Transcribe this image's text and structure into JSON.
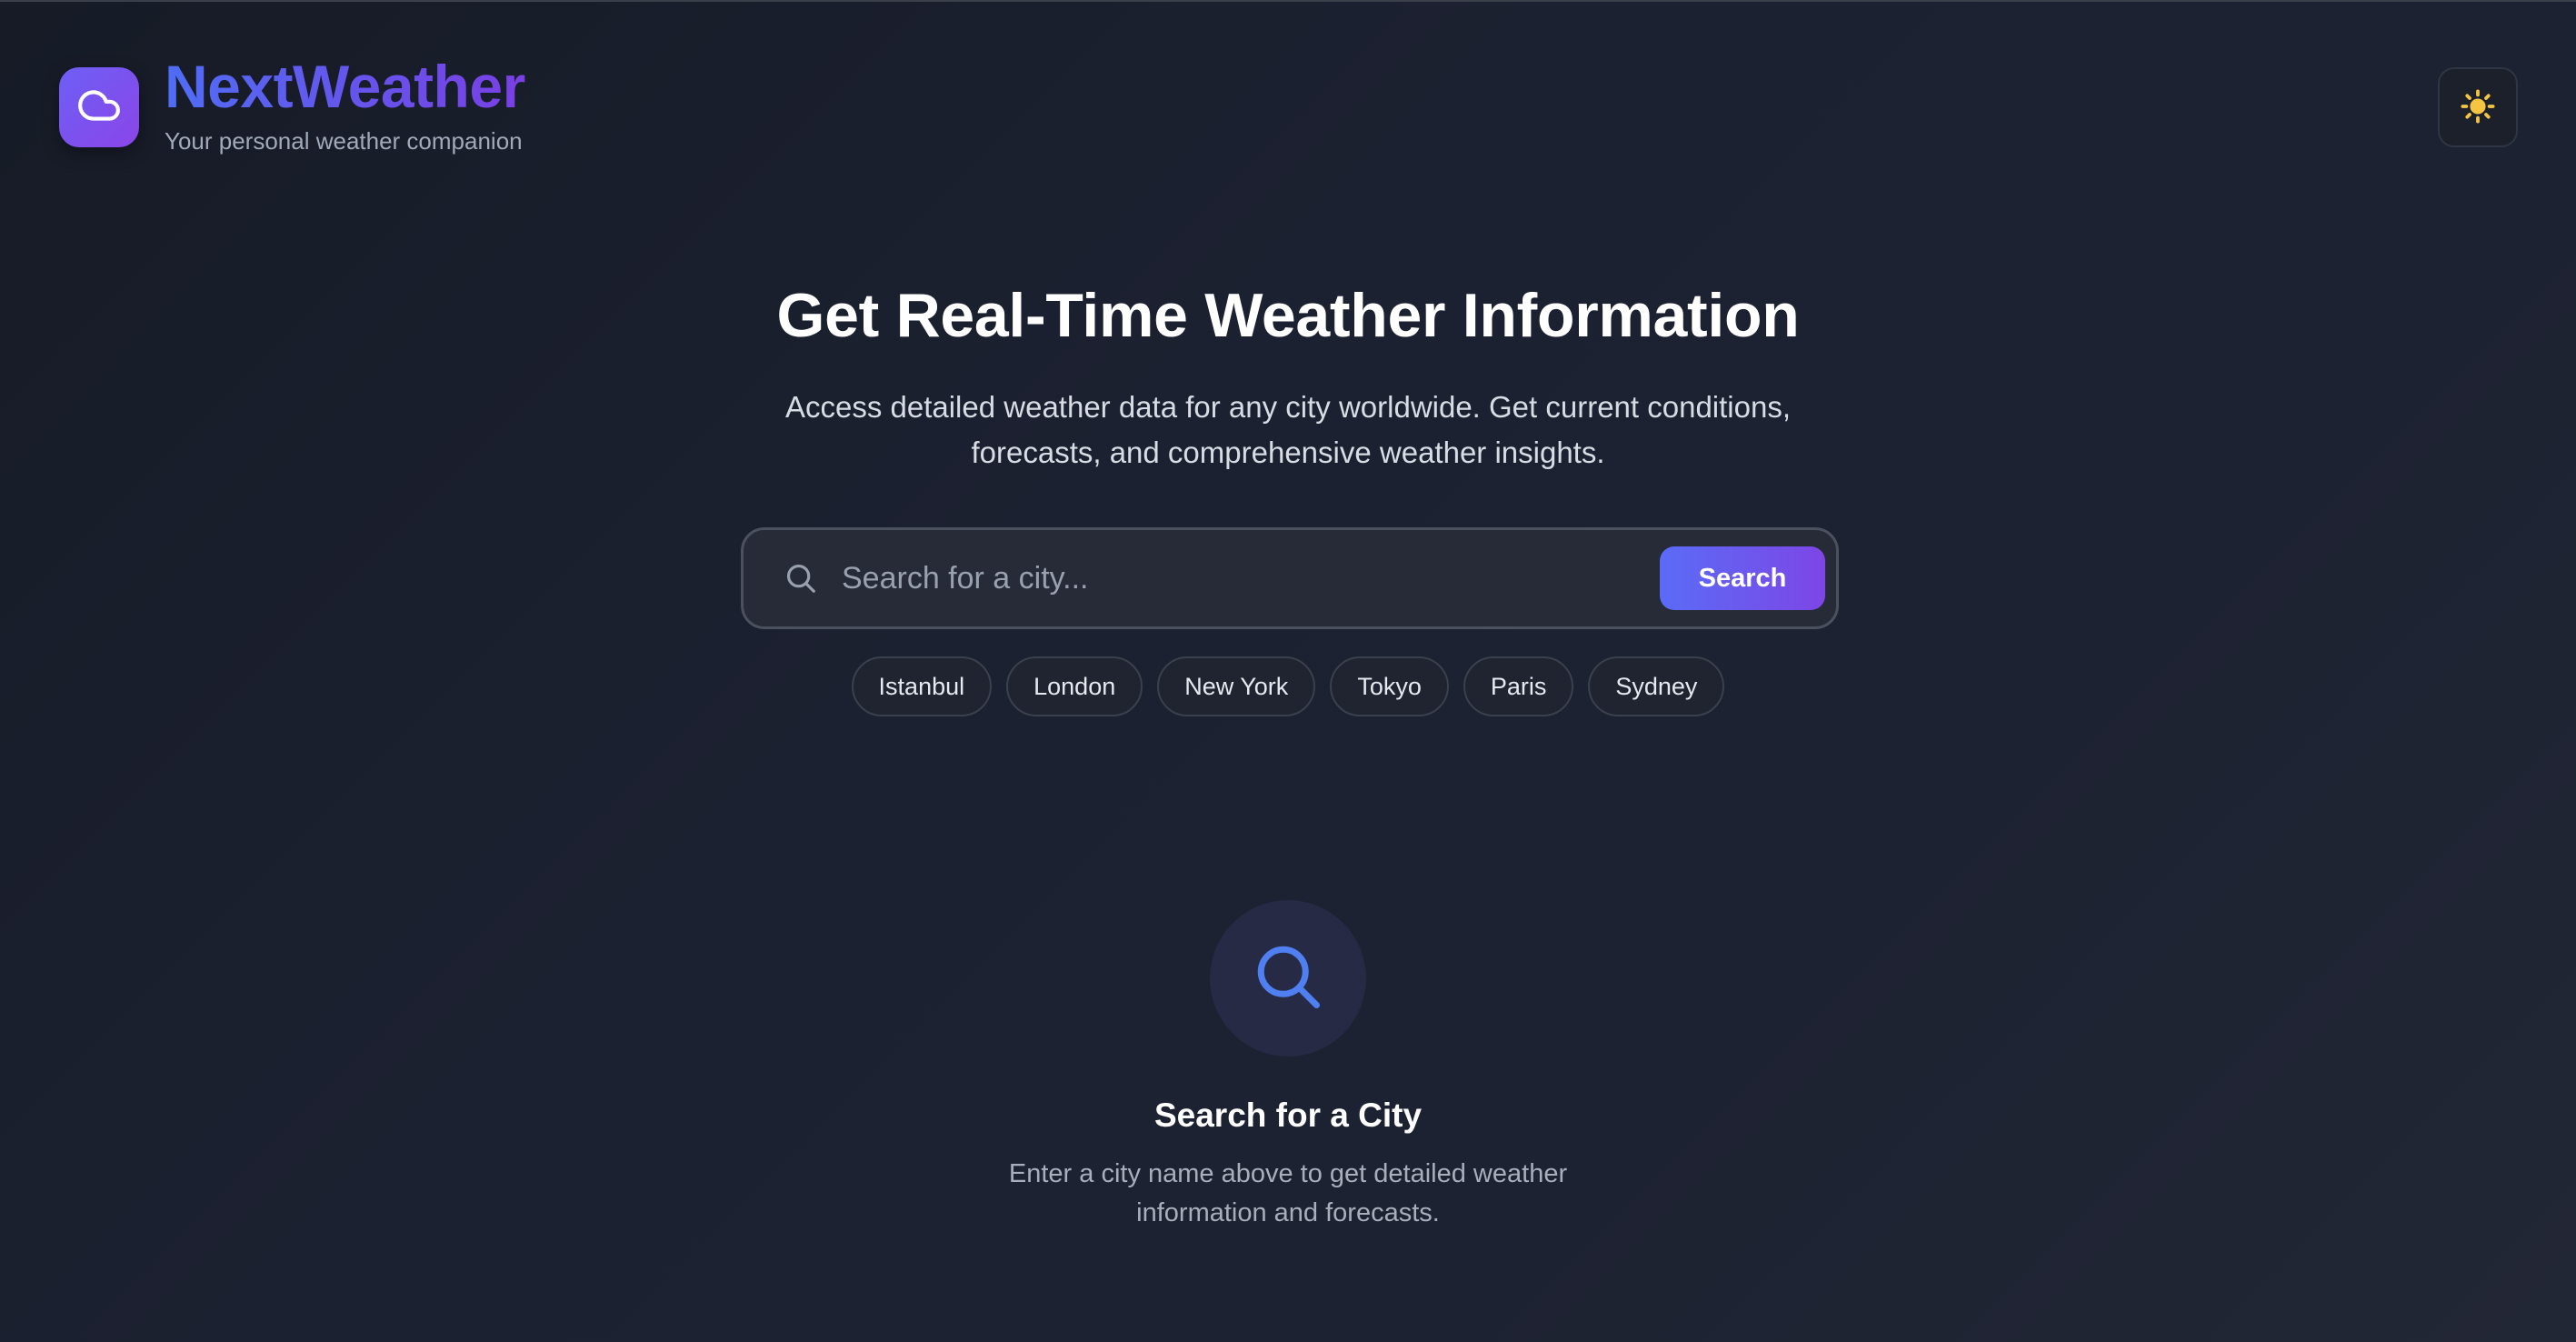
{
  "header": {
    "brand_icon": "cloud-icon",
    "title": "NextWeather",
    "subtitle": "Your personal weather companion",
    "theme_toggle_icon": "sun-icon"
  },
  "hero": {
    "title": "Get Real-Time Weather Information",
    "description_line1": "Access detailed weather data for any city worldwide. Get current conditions,",
    "description_line2": "forecasts, and comprehensive weather insights."
  },
  "search": {
    "icon": "search-icon",
    "placeholder": "Search for a city...",
    "value": "",
    "button_label": "Search"
  },
  "quick_cities": [
    "Istanbul",
    "London",
    "New York",
    "Tokyo",
    "Paris",
    "Sydney"
  ],
  "empty_state": {
    "icon": "search-icon",
    "title": "Search for a City",
    "description_line1": "Enter a city name above to get detailed weather",
    "description_line2": "information and forecasts."
  },
  "colors": {
    "accent_start": "#4f6df5",
    "accent_end": "#7a3fe4",
    "sun": "#f5c542",
    "background": "#1c2131"
  }
}
